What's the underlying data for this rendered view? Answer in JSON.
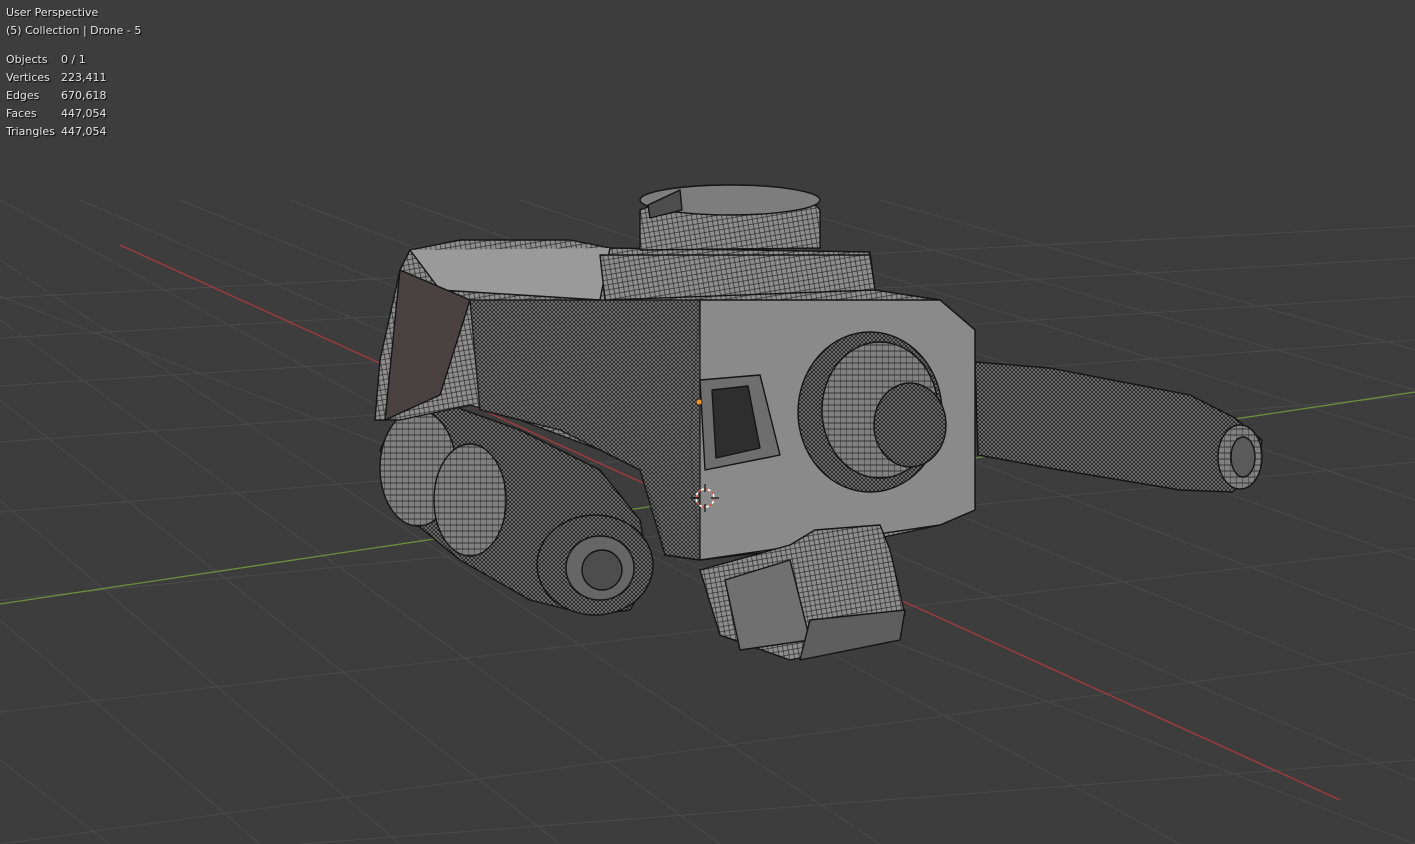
{
  "viewport": {
    "view_name": "User Perspective",
    "collection_info": "(5) Collection | Drone - 5"
  },
  "statistics": [
    {
      "label": "Objects",
      "value": "0 / 1"
    },
    {
      "label": "Vertices",
      "value": "223,411"
    },
    {
      "label": "Edges",
      "value": "670,618"
    },
    {
      "label": "Faces",
      "value": "447,054"
    },
    {
      "label": "Triangles",
      "value": "447,054"
    }
  ],
  "colors": {
    "background": "#3d3d3d",
    "grid": "#4a4a4a",
    "x_axis": "#a83a3a",
    "y_axis": "#6b8f3a",
    "mesh_fill": "#8e8e8e",
    "wire": "#1a1a1a",
    "cursor": "#e05a3a"
  },
  "scene": {
    "object_name": "Drone - 5",
    "shading": "solid-wireframe",
    "show_3d_cursor": true,
    "show_origin": true
  }
}
